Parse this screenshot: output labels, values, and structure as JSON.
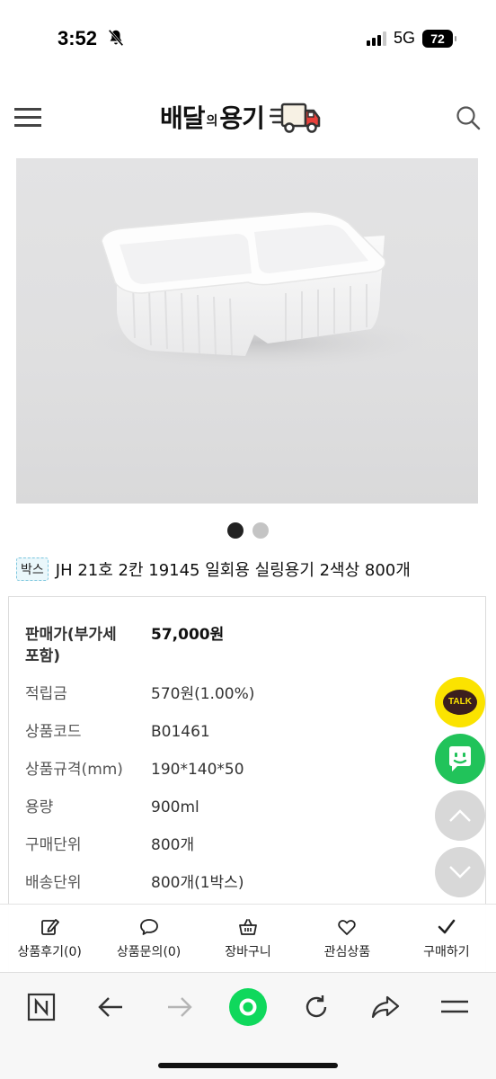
{
  "status_bar": {
    "time": "3:52",
    "network": "5G",
    "battery": "72"
  },
  "header": {
    "logo_main": "배달",
    "logo_small": "의",
    "logo_end": "용기"
  },
  "carousel": {
    "total_dots": 2,
    "active_index": 0
  },
  "product": {
    "tag": "박스",
    "title": "JH 21호 2칸 19145 일회용 실링용기 2색상 800개"
  },
  "info": [
    {
      "label_line1": "판매가(부가세",
      "label_line2": "포함)",
      "value": "57,000원"
    },
    {
      "label": "적립금",
      "value": "570원(1.00%)"
    },
    {
      "label": "상품코드",
      "value": "B01461"
    },
    {
      "label": "상품규격(mm)",
      "value": "190*140*50"
    },
    {
      "label": "용량",
      "value": "900ml"
    },
    {
      "label": "구매단위",
      "value": "800개"
    },
    {
      "label": "배송단위",
      "value": "800개(1박스)"
    }
  ],
  "floating": {
    "kakao_label": "TALK"
  },
  "actions": [
    {
      "label": "상품후기(0)",
      "icon": "edit-icon"
    },
    {
      "label": "상품문의(0)",
      "icon": "chat-bubble-icon"
    },
    {
      "label": "장바구니",
      "icon": "basket-icon"
    },
    {
      "label": "관심상품",
      "icon": "heart-icon"
    },
    {
      "label": "구매하기",
      "icon": "check-icon"
    }
  ],
  "browser": {
    "buttons": [
      "naver-icon",
      "back-arrow-icon",
      "forward-arrow-icon",
      "home-green-icon",
      "refresh-icon",
      "share-icon",
      "menu-icon"
    ]
  }
}
